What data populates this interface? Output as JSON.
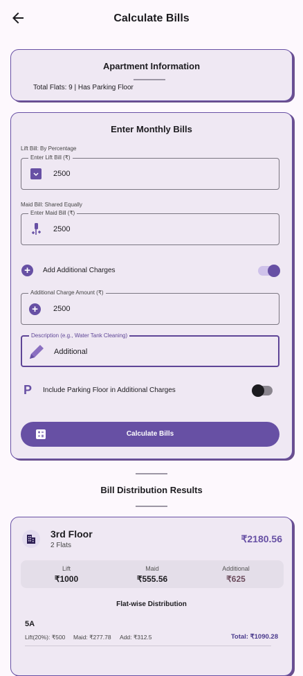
{
  "header": {
    "title": "Calculate Bills"
  },
  "apartment": {
    "title": "Apartment Information",
    "info": "Total Flats: 9 | Has Parking Floor"
  },
  "bills": {
    "title": "Enter Monthly Bills",
    "lift_caption": "Lift Bill: By Percentage",
    "lift_label": "Enter Lift Bill (₹)",
    "lift_value": "2500",
    "maid_caption": "Maid Bill: Shared Equally",
    "maid_label": "Enter Maid Bill (₹)",
    "maid_value": "2500",
    "additional_toggle_label": "Add Additional Charges",
    "additional_on": true,
    "additional_label": "Additional Charge Amount (₹)",
    "additional_value": "2500",
    "desc_label": "Description (e.g., Water Tank Cleaning)",
    "desc_value": "Additional",
    "parking_label": "Include Parking Floor in Additional Charges",
    "parking_on": false,
    "calculate_label": "Calculate Bills"
  },
  "results": {
    "title": "Bill Distribution Results",
    "floor": {
      "name": "3rd Floor",
      "flats": "2 Flats",
      "total": "₹2180.56",
      "lift_label": "Lift",
      "lift_value": "₹1000",
      "maid_label": "Maid",
      "maid_value": "₹555.56",
      "additional_label": "Additional",
      "additional_value": "₹625",
      "flatwise_title": "Flat-wise Distribution",
      "flat": {
        "name": "5A",
        "lift": "Lift(20%): ₹500",
        "maid": "Maid: ₹277.78",
        "add": "Add: ₹312.5",
        "total": "Total: ₹1090.28"
      }
    }
  },
  "colors": {
    "primary": "#6750a4",
    "card": "#efe8f3",
    "background": "#fdf8fd"
  }
}
